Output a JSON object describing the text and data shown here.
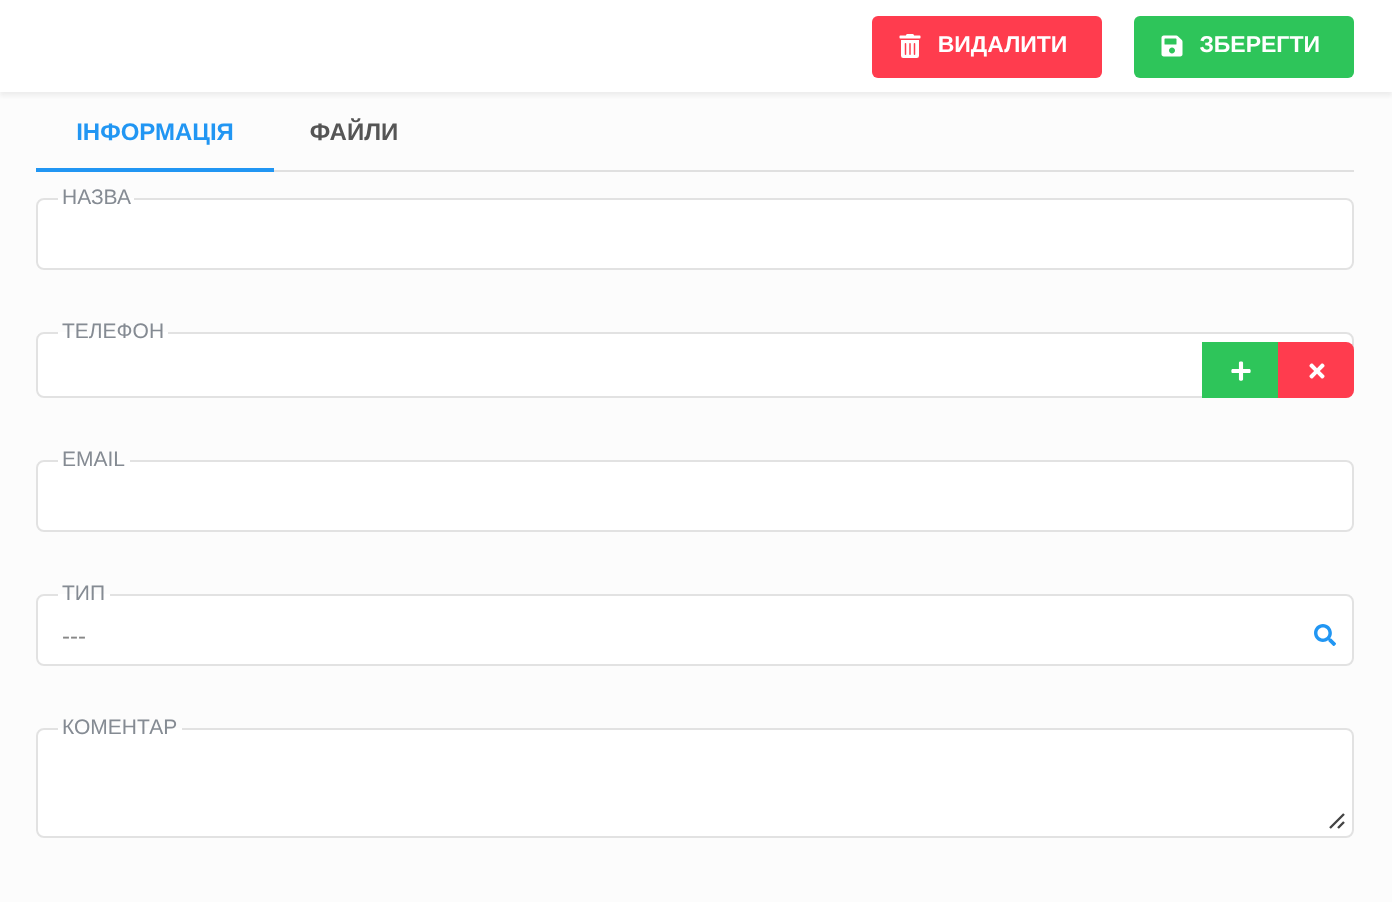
{
  "toolbar": {
    "buttons": [
      {
        "kind": "delete",
        "label": "ВИДАЛИТИ"
      },
      {
        "kind": "save",
        "label": "ЗБЕРЕГТИ"
      }
    ]
  },
  "tabs": [
    {
      "label": "ІНФОРМАЦІЯ",
      "selected": true
    },
    {
      "label": "ФАЙЛИ",
      "selected": false
    }
  ],
  "fields": [
    {
      "kind": "text",
      "label": "НАЗВА"
    },
    {
      "kind": "phone",
      "label": "ТЕЛЕФОН"
    },
    {
      "kind": "text",
      "label": "EMAIL"
    },
    {
      "kind": "lookup",
      "label": "ТИП",
      "value": "---"
    },
    {
      "kind": "textarea",
      "label": "КОМЕНТАР"
    }
  ]
}
